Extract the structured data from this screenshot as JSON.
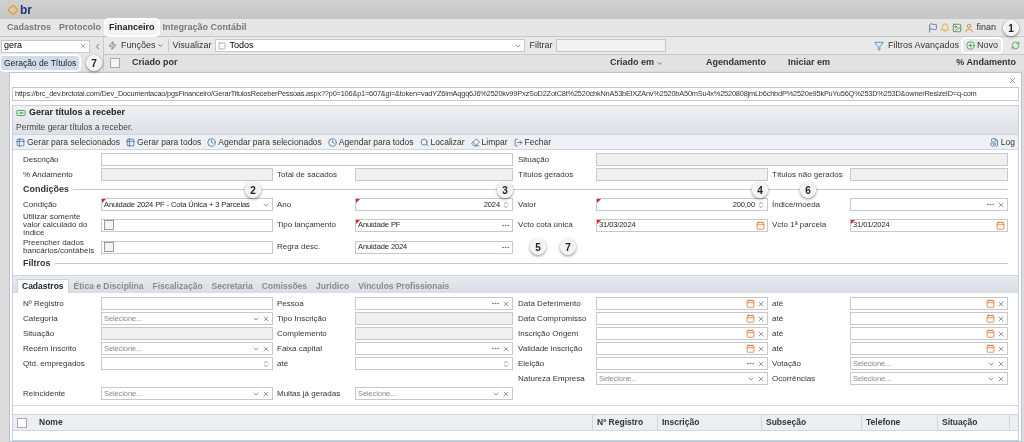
{
  "header": {
    "logo": "br"
  },
  "menu": {
    "tabs": [
      {
        "label": "Cadastros",
        "selected": false,
        "highlighted": false
      },
      {
        "label": "Protocolo",
        "selected": false,
        "highlighted": false
      },
      {
        "label": "Financeiro",
        "selected": true,
        "highlighted": true
      },
      {
        "label": "Integração Contábil",
        "selected": false,
        "highlighted": false
      }
    ],
    "user": "finan"
  },
  "sidebar": {
    "search": {
      "value": "gera"
    },
    "items": [
      {
        "label": "Geração de Títulos",
        "selected": true,
        "highlighted": true
      }
    ]
  },
  "toolbar": {
    "functions": "Funções",
    "view_label": "Visualizar",
    "view_value": "Todos",
    "filter_label": "Filtrar",
    "advanced_filters": "Filtros Avançados",
    "new_button": {
      "label": "Novo",
      "highlighted": true
    }
  },
  "grid": {
    "select_all": {
      "checked": false
    },
    "columns": [
      {
        "label": "Criado por",
        "sorted": false
      },
      {
        "label": "Criado em",
        "sorted": true
      },
      {
        "label": "Agendamento",
        "sorted": false
      },
      {
        "label": "Iniciar em",
        "sorted": false
      },
      {
        "label": "% Andamento",
        "sorted": false
      }
    ]
  },
  "modal": {
    "url": "https://brc_dev.brctotal.com/Dev_Documentacao/pgsFinanceiro/GerarTitulosReceberPessoas.aspx??p0=106&p1=607&gi=&token=vadYZ6imAqgq6J6%2520kv99PxzSoD2ZotC8t%2520cbkNnA53bElXZAnv%2520bA50mSu4x%2520808jmLb6chbdP%2520e95kPuYu56Q%253D%253D&ownerResizeID=q-com",
    "title": "Gerar títulos a receber",
    "subtitle": "Permite gerar títulos a receber.",
    "actions": [
      {
        "label": "Gerar para selecionados",
        "kind": "generate"
      },
      {
        "label": "Gerar para todos",
        "kind": "generate"
      },
      {
        "label": "Agendar para selecionados",
        "kind": "schedule"
      },
      {
        "label": "Agendar para todos",
        "kind": "schedule"
      },
      {
        "label": "Localizar",
        "kind": "search"
      },
      {
        "label": "Limpar",
        "kind": "clear"
      },
      {
        "label": "Fechar",
        "kind": "close"
      }
    ],
    "log": "Log",
    "general": [
      {
        "left": [
          {
            "label": "Descrição",
            "kind": "wide"
          }
        ],
        "right": [
          {
            "label": "Situação",
            "kind": "wide_disabled"
          }
        ]
      },
      {
        "left": [
          {
            "label": "% Andamento",
            "kind": "disabled"
          },
          {
            "label": "Total de sacados",
            "kind": "disabled"
          }
        ],
        "right": [
          {
            "label": "Títulos gerados",
            "kind": "disabled"
          },
          {
            "label": "Títulos não gerados",
            "kind": "disabled"
          }
        ]
      }
    ],
    "conditions_title": "Condições",
    "conditions": [
      {
        "left": [
          {
            "label": "Condição",
            "kind": "select",
            "value": "Anuidade 2024 PF - Cota Única + 3 Parcelas",
            "required": true,
            "clearable": false
          },
          {
            "label": "Ano",
            "kind": "spinner",
            "value": "2024",
            "required": true
          }
        ],
        "right": [
          {
            "label": "Valor",
            "kind": "spinner",
            "value": "200,00",
            "required": true
          },
          {
            "label": "Índice/moeda",
            "kind": "lookup",
            "required": false,
            "clearable": true
          }
        ]
      },
      {
        "left": [
          {
            "label": "Utilizar somente valor calculado do índice",
            "kind": "checkbox",
            "checked": false
          },
          {
            "label": "Tipo lançamento",
            "kind": "lookup",
            "value": "Anuidade PF",
            "required": true,
            "clearable": false
          }
        ],
        "right": [
          {
            "label": "Vcto cota única",
            "kind": "date",
            "value": "31/03/2024",
            "required": true,
            "clearable": false
          },
          {
            "label": "Vcto 1ª parcela",
            "kind": "date",
            "value": "31/01/2024",
            "required": true,
            "clearable": false
          }
        ]
      },
      {
        "left": [
          {
            "label": "Preencher dados bancários/contábeis",
            "kind": "checkbox",
            "checked": false
          },
          {
            "label": "Regra desc.",
            "kind": "lookup",
            "value": "Anuidade 2024",
            "required": false,
            "clearable": false
          }
        ]
      }
    ],
    "filters_title": "Filtros",
    "filter_tabs": [
      {
        "label": "Cadastros",
        "selected": true
      },
      {
        "label": "Ética e Disciplina",
        "selected": false
      },
      {
        "label": "Fiscalização",
        "selected": false
      },
      {
        "label": "Secretaria",
        "selected": false
      },
      {
        "label": "Comissões",
        "selected": false
      },
      {
        "label": "Jurídico",
        "selected": false
      },
      {
        "label": "Vínculos Profissionais",
        "selected": false
      }
    ],
    "filter_rows": [
      {
        "left": [
          {
            "label": "Nº Registro",
            "kind": "text"
          },
          {
            "label": "Pessoa",
            "kind": "lookup",
            "clearable": true
          }
        ],
        "right": [
          {
            "label": "Data Deferimento",
            "kind": "date",
            "clearable": true
          },
          {
            "label": "até",
            "kind": "date",
            "clearable": true
          }
        ]
      },
      {
        "left": [
          {
            "label": "Categoria",
            "kind": "select",
            "placeholder": "Selecione...",
            "clearable": true
          },
          {
            "label": "Tipo Inscrição",
            "kind": "disabled"
          }
        ],
        "right": [
          {
            "label": "Data Compromisso",
            "kind": "date",
            "clearable": true
          },
          {
            "label": "até",
            "kind": "date",
            "clearable": true
          }
        ]
      },
      {
        "left": [
          {
            "label": "Situação",
            "kind": "disabled"
          },
          {
            "label": "Complemento",
            "kind": "disabled"
          }
        ],
        "right": [
          {
            "label": "Inscrição Origem",
            "kind": "date",
            "clearable": true
          },
          {
            "label": "até",
            "kind": "date",
            "clearable": true
          }
        ]
      },
      {
        "left": [
          {
            "label": "Recém Inscrito",
            "kind": "select",
            "placeholder": "Selecione...",
            "clearable": true
          },
          {
            "label": "Faixa capital",
            "kind": "lookup",
            "clearable": true
          }
        ],
        "right": [
          {
            "label": "Validade inscrição",
            "kind": "date",
            "clearable": true
          },
          {
            "label": "até",
            "kind": "date",
            "clearable": true
          }
        ]
      },
      {
        "left": [
          {
            "label": "Qtd. empregados",
            "kind": "spinner"
          },
          {
            "label": "até",
            "kind": "spinner"
          }
        ],
        "right": [
          {
            "label": "Eleição",
            "kind": "lookup",
            "clearable": true
          },
          {
            "label": "Votação",
            "kind": "select",
            "placeholder": "Selecione...",
            "clearable": true
          }
        ]
      },
      {
        "right": [
          {
            "label": "Natureza Empresa",
            "kind": "select",
            "placeholder": "Selecione...",
            "clearable": true
          },
          {
            "label": "Ocorrências",
            "kind": "select",
            "placeholder": "Selecione...",
            "clearable": true
          }
        ]
      },
      {
        "left": [
          {
            "label": "Reincidente",
            "kind": "select",
            "placeholder": "Selecione...",
            "clearable": true
          },
          {
            "label": "Multas já geradas",
            "kind": "select",
            "placeholder": "Selecione...",
            "clearable": true
          }
        ]
      }
    ],
    "results_select_all": {
      "checked": false
    },
    "results_columns": [
      "Nome",
      "Nº Registro",
      "Inscrição",
      "Subseção",
      "Telefone",
      "Situação"
    ]
  },
  "callouts": [
    {
      "number": "1"
    },
    {
      "number": "2"
    },
    {
      "number": "3"
    },
    {
      "number": "4"
    },
    {
      "number": "5"
    },
    {
      "number": "6"
    },
    {
      "number": "7"
    },
    {
      "number": "7"
    }
  ]
}
